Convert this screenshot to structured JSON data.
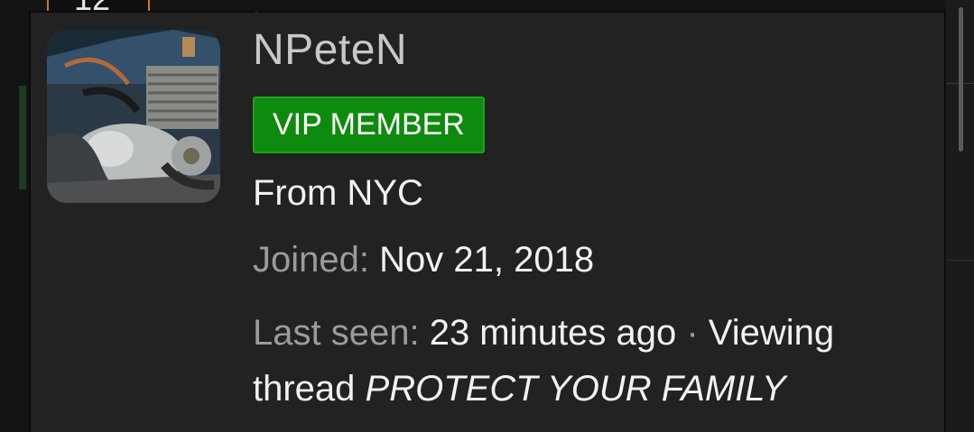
{
  "background": {
    "top_box_text": "12"
  },
  "member_card": {
    "username": "NPeteN",
    "badge": "VIP MEMBER",
    "location": "From NYC",
    "joined_label": "Joined:",
    "joined_date": "Nov 21, 2018",
    "last_seen_label": "Last seen:",
    "last_seen_value": "23 minutes ago",
    "separator": "·",
    "activity_prefix": "Viewing thread",
    "activity_thread": "PROTECT YOUR FAMILY",
    "avatar_icon": "motorcycle-engine-photo",
    "colors": {
      "card_bg": "#222222",
      "badge_bg": "#0e8a0e",
      "badge_border": "#1fa31f",
      "muted_text": "#9b9b9b",
      "bright_text": "#f2f2f2"
    }
  }
}
